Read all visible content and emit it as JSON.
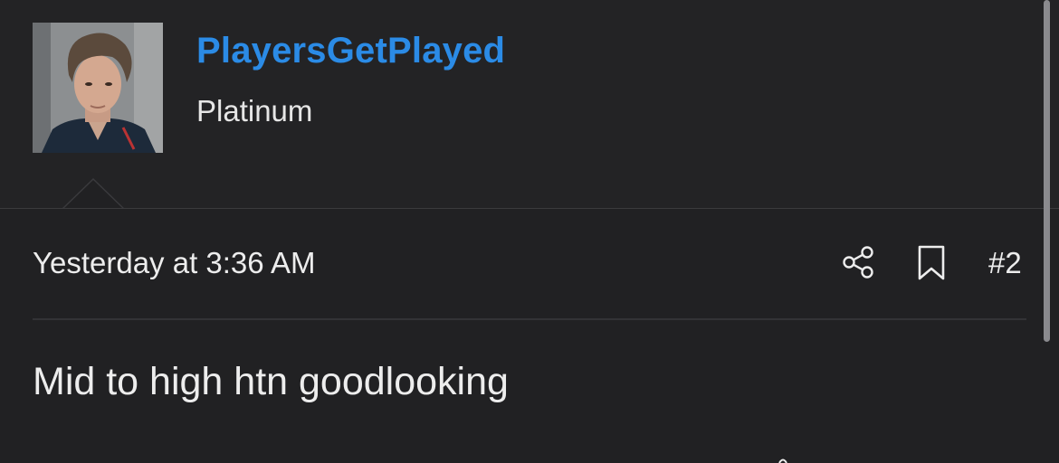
{
  "user": {
    "username": "PlayersGetPlayed",
    "title": "Platinum",
    "avatar_icon": "user-avatar-photo"
  },
  "post": {
    "date": "Yesterday at 3:36 AM",
    "number": "#2",
    "body": "Mid to high htn goodlooking"
  },
  "actions": {
    "share_icon": "share-icon",
    "bookmark_icon": "bookmark-icon"
  },
  "colors": {
    "background": "#212123",
    "username": "#2b8be6",
    "text": "#ededed"
  }
}
